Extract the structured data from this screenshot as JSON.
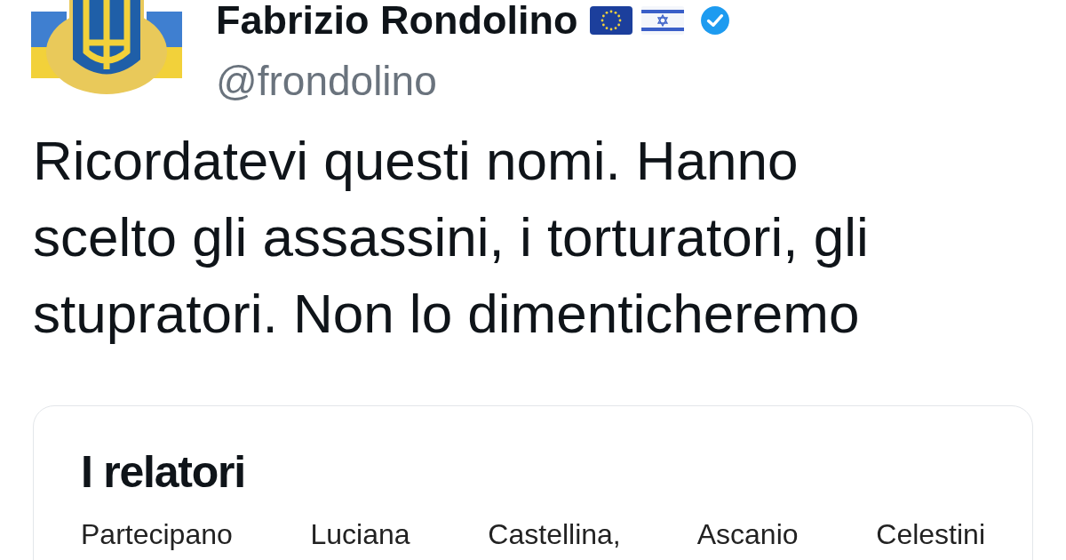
{
  "author": {
    "name": "Fabrizio Rondolino",
    "handle": "@frondolino",
    "verified": true
  },
  "tweet": {
    "text": "Ricordatevi questi nomi. Hanno scelto gli assassini, i torturatori, gli stupratori. Non lo dimenticheremo"
  },
  "card": {
    "title": "I relatori",
    "text": "Partecipano Luciana Castellina, Ascanio Celestini"
  }
}
